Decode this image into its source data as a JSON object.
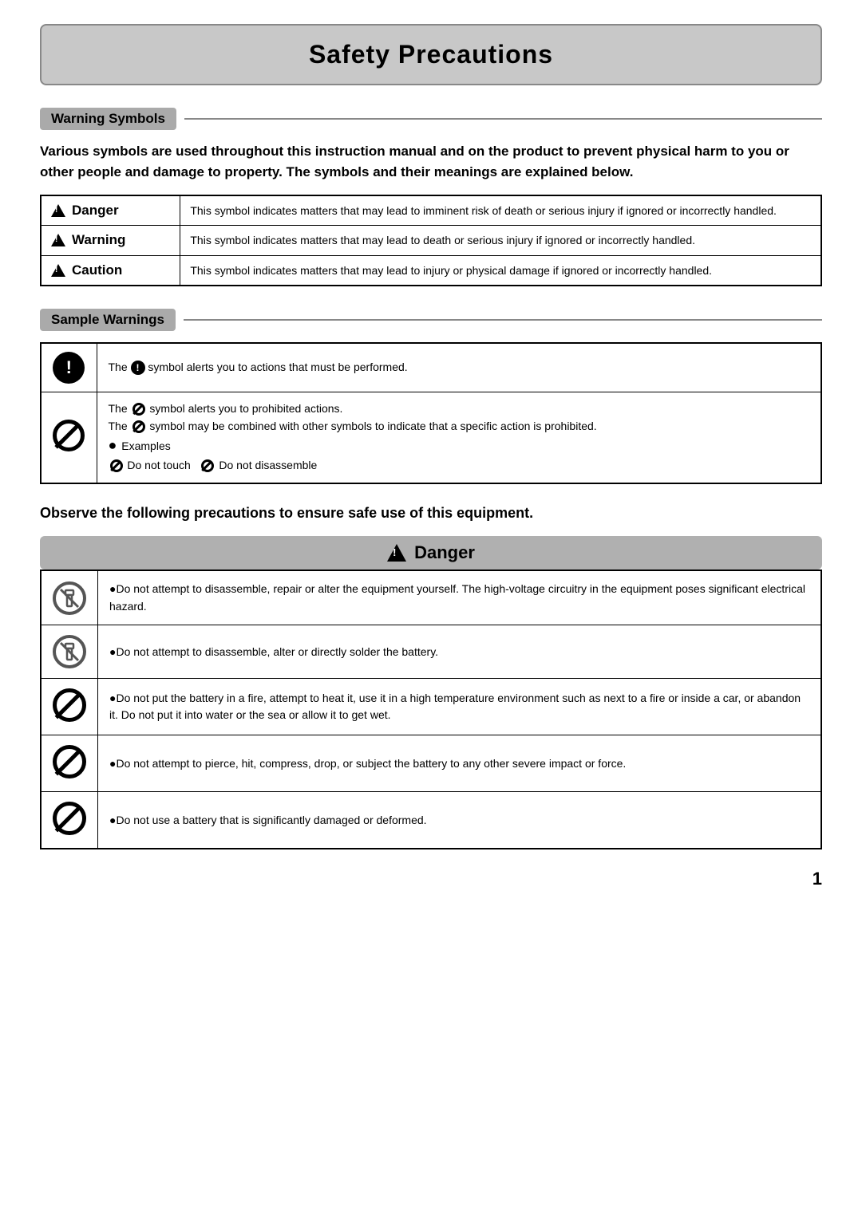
{
  "page": {
    "title": "Safety Precautions",
    "page_number": "1",
    "warning_symbols_label": "Warning Symbols",
    "sample_warnings_label": "Sample Warnings",
    "intro": "Various symbols are used throughout this instruction manual and on the product to prevent physical harm to you or other people and damage to property. The symbols and their meanings are explained below.",
    "symbols": [
      {
        "label": "Danger",
        "description": "This symbol indicates matters that may lead to imminent risk of death or serious injury if ignored or incorrectly handled."
      },
      {
        "label": "Warning",
        "description": "This symbol indicates matters that may lead to death or serious injury if ignored or incorrectly handled."
      },
      {
        "label": "Caution",
        "description": "This symbol indicates matters that may lead to injury or physical damage if ignored or incorrectly handled."
      }
    ],
    "sample_warnings": [
      {
        "icon_type": "mandatory",
        "text": "The ⓘ symbol alerts you to actions that must be performed."
      },
      {
        "icon_type": "prohibit",
        "text_lines": [
          "The ⊝ symbol alerts you to prohibited actions.",
          "The ⊝ symbol may be combined with other symbols to indicate that a specific action is prohibited.",
          "● Examples",
          "⊝ Do not touch  ⊝ Do not disassemble"
        ]
      }
    ],
    "observe_text": "Observe the following precautions to ensure safe use of this equipment.",
    "danger_section": {
      "label": "Danger",
      "items": [
        {
          "icon_type": "no-tool",
          "text": "●Do not attempt to disassemble, repair or alter the equipment yourself. The high-voltage circuitry in the equipment poses significant electrical hazard."
        },
        {
          "icon_type": "no-tool",
          "text": "●Do not attempt to disassemble, alter or directly solder the battery."
        },
        {
          "icon_type": "prohibit",
          "text": "●Do not put the battery in a fire, attempt to heat it, use it in a high temperature environment such as next to a fire or inside a car, or abandon it. Do not put it into water or the sea or allow it to get wet."
        },
        {
          "icon_type": "prohibit",
          "text": "●Do not attempt to pierce, hit, compress, drop, or subject the battery to any other severe impact or force."
        },
        {
          "icon_type": "prohibit",
          "text": "●Do not use a battery that is significantly damaged or deformed."
        }
      ]
    }
  }
}
